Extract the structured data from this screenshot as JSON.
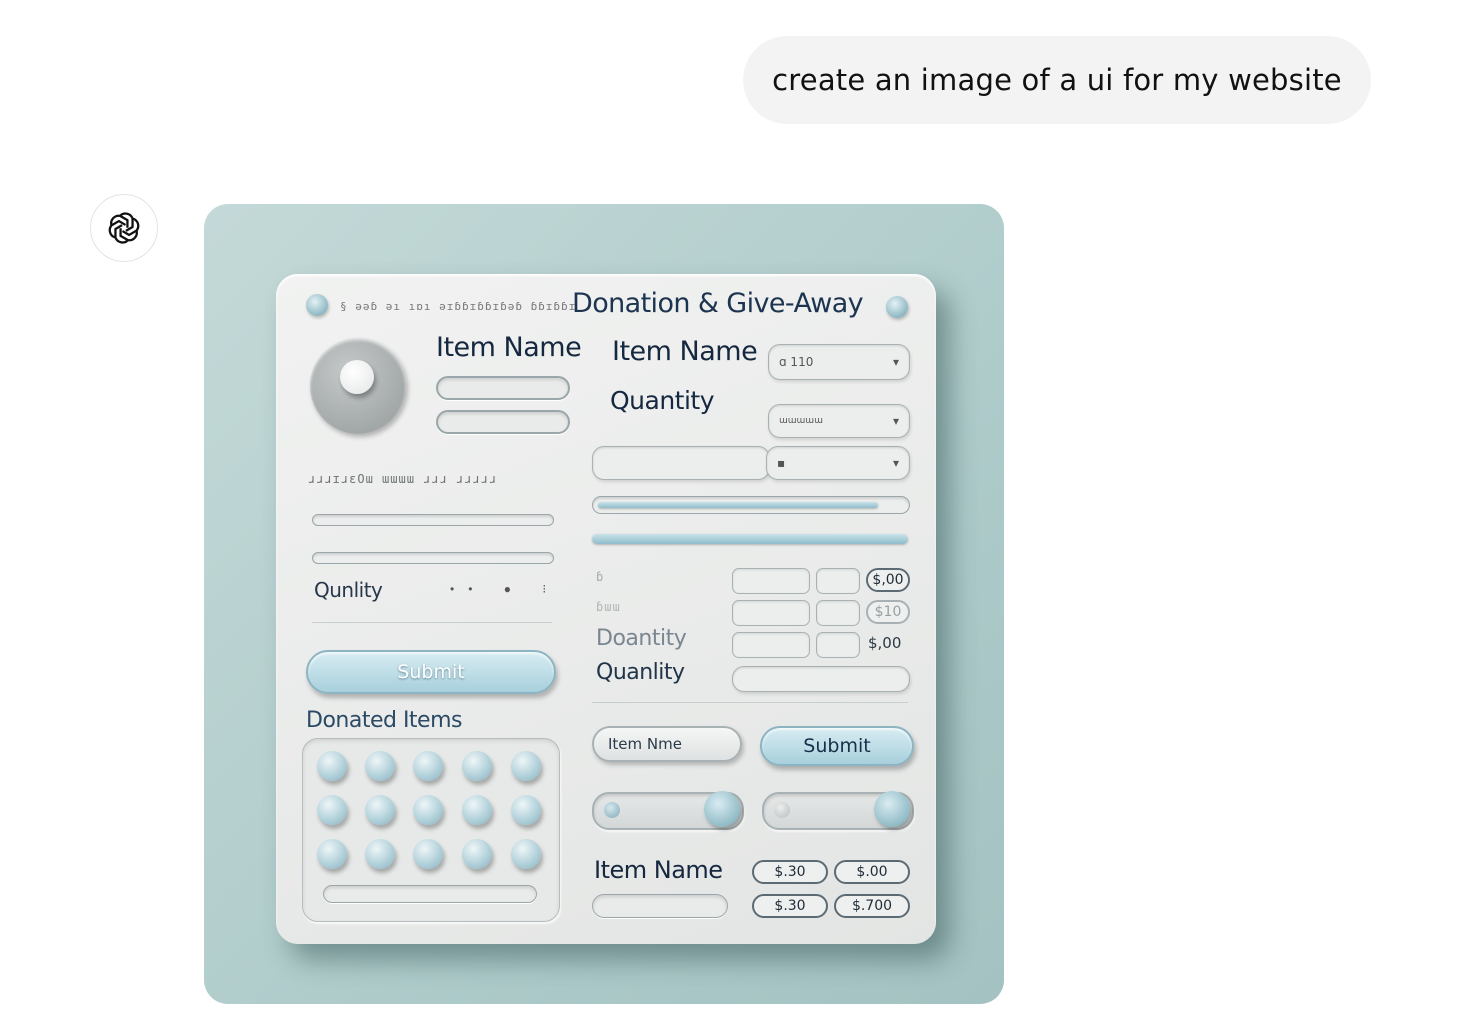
{
  "chat": {
    "user_message": "create an image of a ui for my website"
  },
  "assistant": {
    "avatar_icon": "openai-logo-icon"
  },
  "generated_image": {
    "title": "Donation & Give-Away",
    "faint_header": "§ ǝǝɓ ǝı ıɒı ǝɪɓɓɪɓɓɪɓǝɓ ɓɓɪɓɓɪ",
    "left": {
      "item_name_label": "Item Name",
      "faint_row": "ɹɹɹɪɹɛOɯ ɯɯɯɯ ɹɹɹ ɹɹɹɹɹ",
      "quantity_label": "Qunlity",
      "quantity_dots": "•• ● ⁝",
      "submit_label": "Submit",
      "donated_items_label": "Donated Items"
    },
    "right": {
      "item_name_label": "Item Name",
      "quantity_label": "Quantity",
      "select1_value": "ɑ 110",
      "select2_value": "ɯɯɯɯɯ",
      "select3_value": "▪",
      "row1_label": "ɓ",
      "row2_label": "ɓɯɯ",
      "row3_label": "Doantity",
      "row4_label": "Quanlity",
      "price1": "$,00",
      "price2": "$10",
      "price3": "$,00",
      "item_name_button": "Item Nme",
      "submit_label": "Submit",
      "item_name_label_bottom": "Item Name",
      "chips": [
        "$.30",
        "$.00",
        "$.30",
        "$.700"
      ]
    }
  }
}
